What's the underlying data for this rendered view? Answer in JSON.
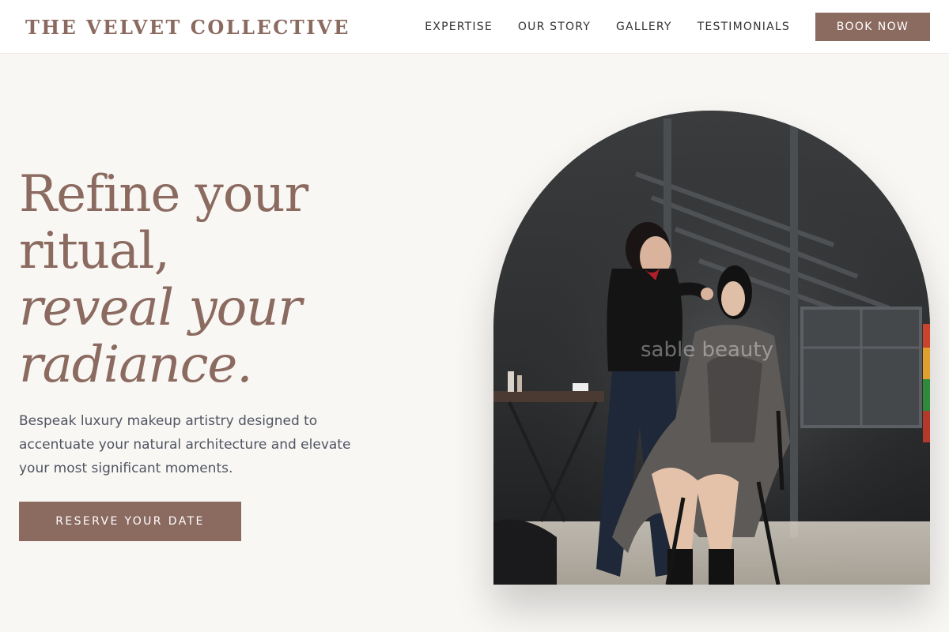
{
  "header": {
    "brand": "THE VELVET COLLECTIVE",
    "nav": [
      {
        "label": "EXPERTISE"
      },
      {
        "label": "OUR STORY"
      },
      {
        "label": "GALLERY"
      },
      {
        "label": "TESTIMONIALS"
      }
    ],
    "cta_label": "BOOK NOW"
  },
  "hero": {
    "title_line1": "Refine your",
    "title_line2": "ritual,",
    "title_line3": "reveal your",
    "title_line4": "radiance.",
    "description": "Bespeak luxury makeup artistry designed to accentuate your natural architecture and elevate your most significant moments.",
    "cta_label": "RESERVE YOUR DATE"
  },
  "image": {
    "caption": "sable beauty"
  },
  "colors": {
    "accent": "#8b6a60",
    "background": "#f9f7f4",
    "header_bg": "#ffffff",
    "text": "#4f5561"
  }
}
